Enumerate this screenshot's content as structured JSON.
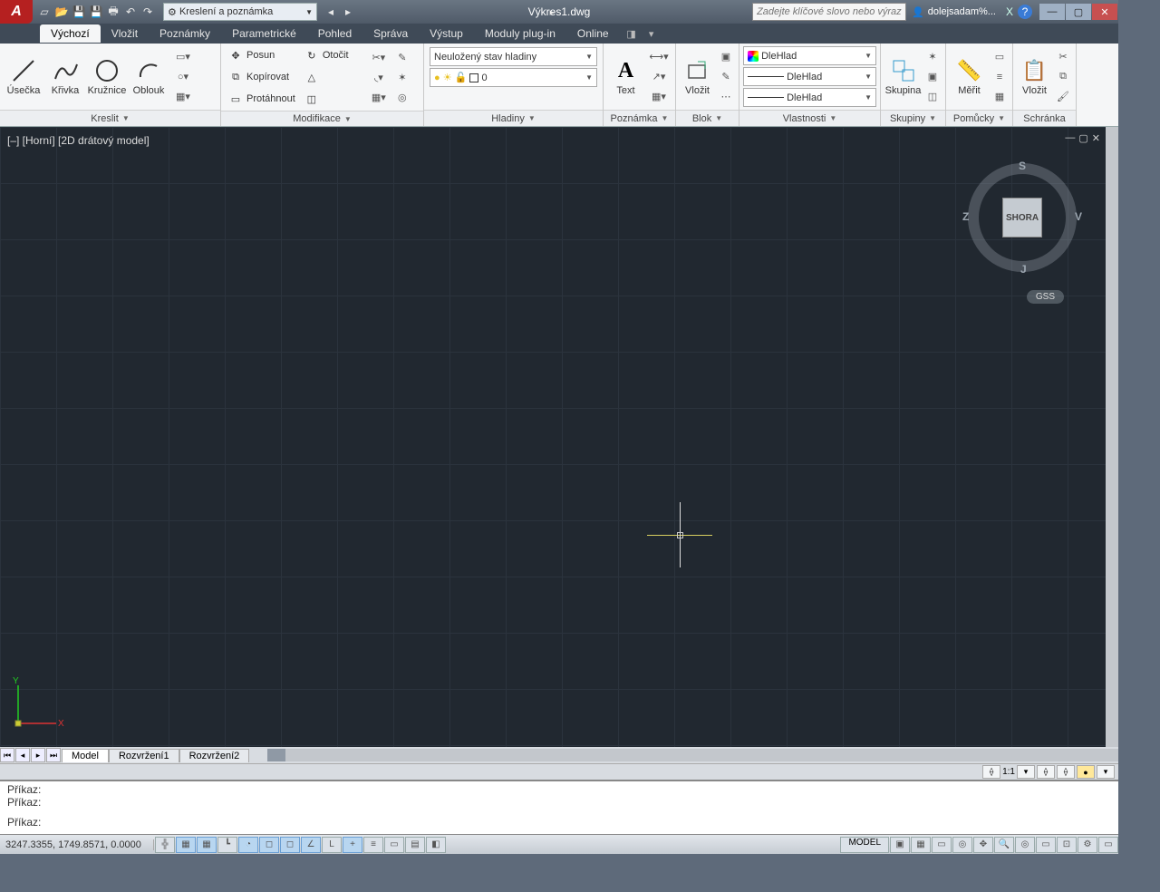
{
  "title": {
    "doc": "Výkres1.dwg",
    "workspace": "Kreslení a poznámka",
    "search_ph": "Zadejte klíčové slovo nebo výraz.",
    "user": "dolejsadam%..."
  },
  "tabs": [
    "Výchozí",
    "Vložit",
    "Poznámky",
    "Parametrické",
    "Pohled",
    "Správa",
    "Výstup",
    "Moduly plug-in",
    "Online"
  ],
  "panels": {
    "draw": {
      "title": "Kreslit",
      "btns": [
        "Úsečka",
        "Křivka",
        "Kružnice",
        "Oblouk"
      ]
    },
    "modify": {
      "title": "Modifikace",
      "btns": [
        "Posun",
        "Otočit",
        "Kopírovat",
        "Zrcadlit",
        "Protáhnout",
        "Měřítko"
      ]
    },
    "layers": {
      "title": "Hladiny",
      "state": "Neuložený stav hladiny",
      "cur": "0"
    },
    "annot": {
      "title": "Poznámka",
      "btn": "Text"
    },
    "block": {
      "title": "Blok",
      "btn": "Vložit"
    },
    "props": {
      "title": "Vlastnosti",
      "val": "DleHlad"
    },
    "groups": {
      "title": "Skupiny",
      "btn": "Skupina"
    },
    "util": {
      "title": "Pomůcky",
      "btn": "Měřit"
    },
    "clip": {
      "title": "Schránka",
      "btn": "Vložit"
    }
  },
  "view": {
    "label": "[–] [Horní] [2D drátový model]",
    "cube": "SHORA",
    "dirs": {
      "n": "S",
      "s": "J",
      "e": "V",
      "w": "Z"
    },
    "gss": "GSS"
  },
  "layout_tabs": [
    "Model",
    "Rozvržení1",
    "Rozvržení2"
  ],
  "cmd": {
    "prompt": "Příkaz:"
  },
  "status": {
    "coords": "3247.3355, 1749.8571, 0.0000",
    "model": "MODEL",
    "scale": "1:1"
  }
}
